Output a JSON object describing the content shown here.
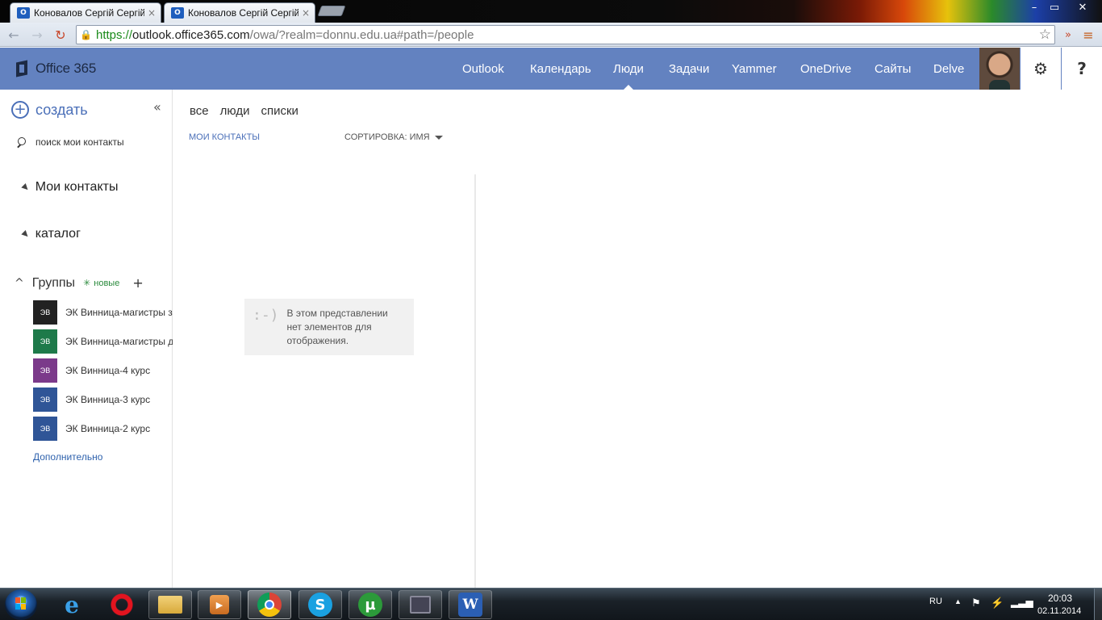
{
  "browser": {
    "tabs": [
      {
        "title": "Коновалов Сергій Сергій",
        "favicon": "outlook-favicon-icon",
        "close": "×"
      },
      {
        "title": "Коновалов Сергій Сергій",
        "favicon": "outlook-favicon-icon",
        "close": "×"
      }
    ],
    "window_controls": {
      "minimize": "–",
      "maximize": "▭",
      "close": "✕"
    },
    "url": {
      "scheme": "https://",
      "host": "outlook.office365.com",
      "path": "/owa/?realm=donnu.edu.ua#path=/people"
    },
    "icons": {
      "back": "←",
      "forward": "→",
      "reload": "↻",
      "bookmark": "☆",
      "overflow": "»",
      "menu": "≡"
    }
  },
  "suite": {
    "logo": "Office 365",
    "nav": [
      "Outlook",
      "Календарь",
      "Люди",
      "Задачи",
      "Yammer",
      "OneDrive",
      "Сайты",
      "Delve"
    ],
    "active_nav": "Люди",
    "settings_glyph": "⚙",
    "help_glyph": "?",
    "colors": {
      "bar": "#6382c0",
      "accent": "#4a6fb8"
    }
  },
  "leftnav": {
    "create_label": "создать",
    "collapse_glyph": "«",
    "search_placeholder": "поиск мои контакты",
    "folders": [
      "Мои контакты",
      "каталог"
    ],
    "groups": {
      "title": "Группы",
      "new_label": "новые",
      "add_glyph": "+",
      "items": [
        {
          "tile": "ЭВ",
          "name": "ЭК Винница-магистры з",
          "color": "#222222"
        },
        {
          "tile": "ЭВ",
          "name": "ЭК Винница-магистры д",
          "color": "#1e7a4a"
        },
        {
          "tile": "ЭВ",
          "name": "ЭК Винница-4 курс",
          "color": "#7b3a8a"
        },
        {
          "tile": "ЭВ",
          "name": "ЭК Винница-3 курс",
          "color": "#2f5597"
        },
        {
          "tile": "ЭВ",
          "name": "ЭК Винница-2 курс",
          "color": "#2f5597"
        }
      ],
      "more_label": "Дополнительно"
    }
  },
  "listpane": {
    "filters": [
      "все",
      "люди",
      "списки"
    ],
    "view_label": "МОИ КОНТАКТЫ",
    "sort_label": "СОРТИРОВКА: ИМЯ",
    "empty": {
      "emoticon": ":-)",
      "text": [
        "В этом представлении",
        "нет элементов для",
        "отображения."
      ]
    }
  },
  "taskbar": {
    "apps": [
      "start-button",
      "internet-explorer-icon",
      "opera-icon",
      "file-explorer-icon",
      "media-player-icon",
      "chrome-icon",
      "skype-icon",
      "utorrent-icon",
      "monitor-app-icon",
      "word-icon"
    ],
    "language": "RU",
    "time": "20:03",
    "date": "02.11.2014"
  }
}
